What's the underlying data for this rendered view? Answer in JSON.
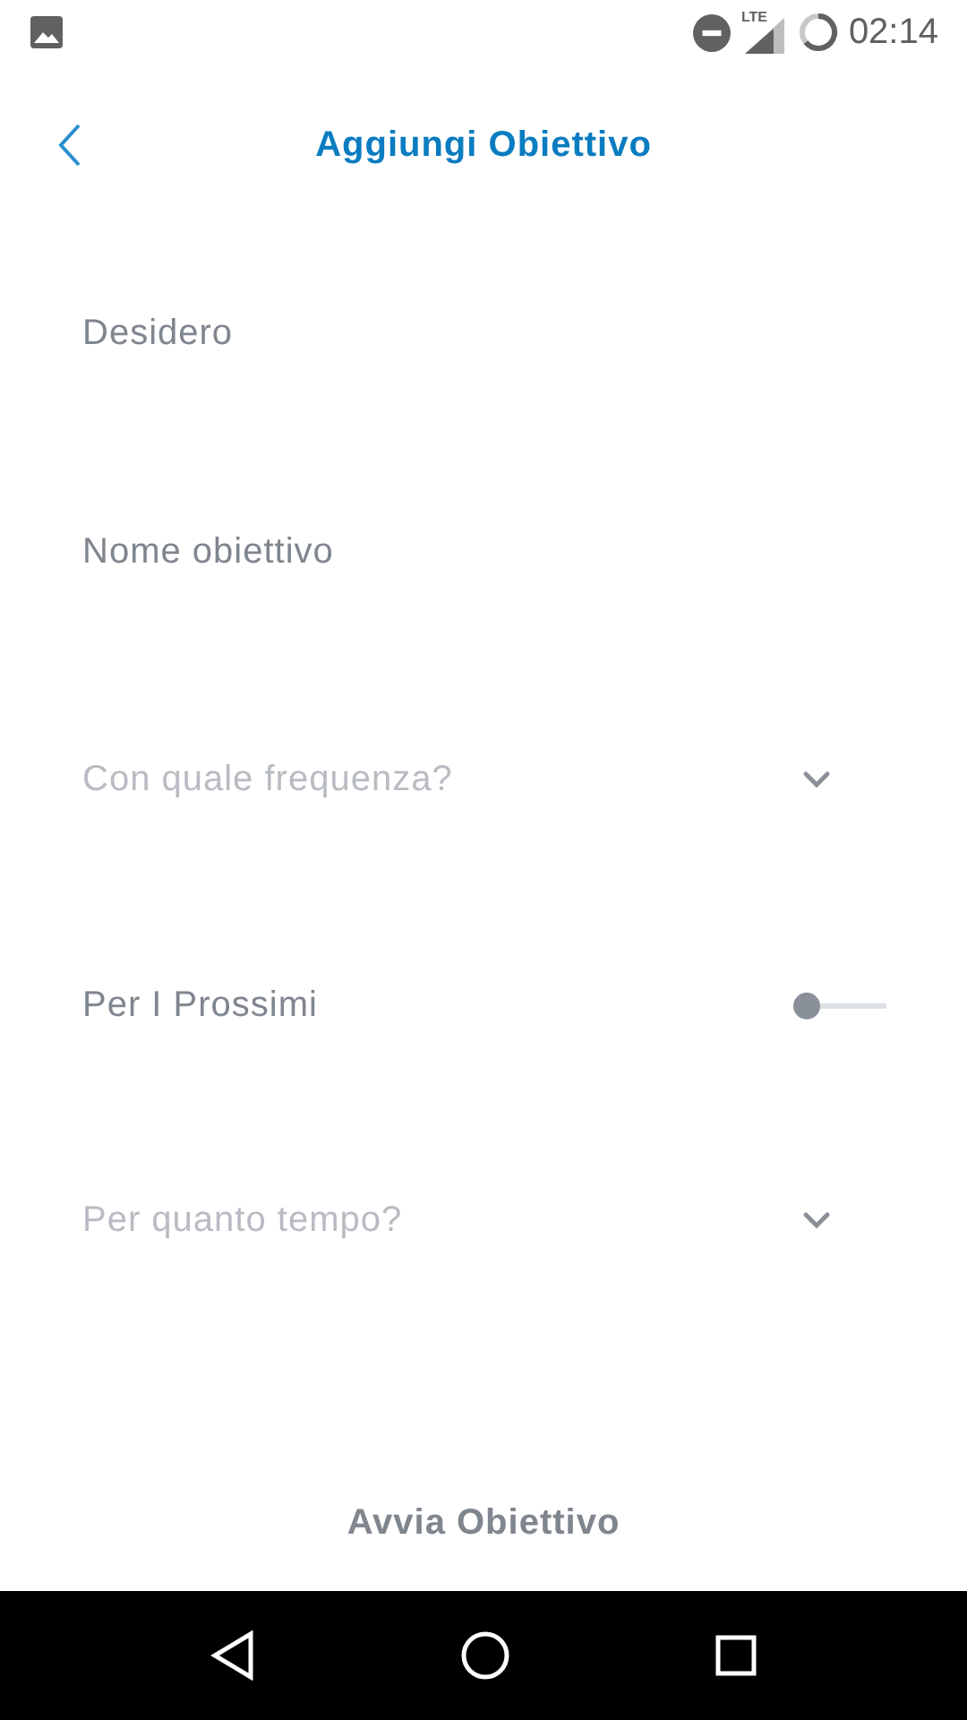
{
  "status_bar": {
    "time": "02:14",
    "network": "LTE"
  },
  "header": {
    "title": "Aggiungi Obiettivo"
  },
  "fields": [
    {
      "kind": "input",
      "placeholder": "Desidero"
    },
    {
      "kind": "input",
      "placeholder": "Nome obiettivo"
    },
    {
      "kind": "select",
      "label": "Con quale frequenza?"
    },
    {
      "kind": "slider",
      "label": "Per I Prossimi",
      "level": 0
    },
    {
      "kind": "select",
      "label": "Per quanto tempo?"
    }
  ],
  "action": {
    "label": "Avvia Obiettivo"
  }
}
